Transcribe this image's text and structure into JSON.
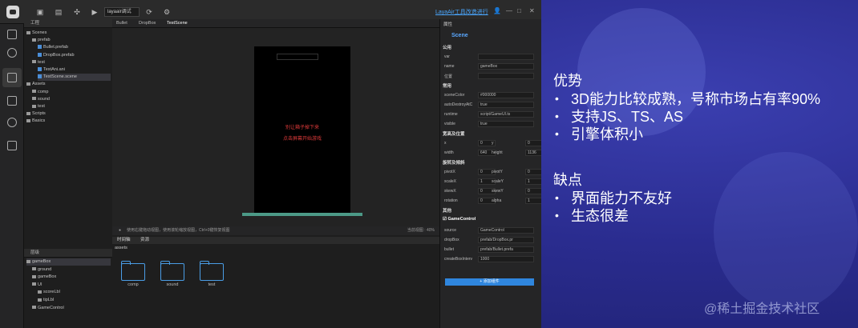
{
  "window": {
    "select_value": "layaair调试",
    "link": "LayaAir工具改造进行",
    "icons": [
      "folder-icon",
      "save-icon",
      "build-icon",
      "play-icon",
      "settings-icon"
    ]
  },
  "project_panel": {
    "title": "工程",
    "items": [
      {
        "label": "Scenes",
        "depth": 0,
        "type": "folder"
      },
      {
        "label": "prefab",
        "depth": 1,
        "type": "folder"
      },
      {
        "label": "Bullet.prefab",
        "depth": 2,
        "type": "file"
      },
      {
        "label": "DropBox.prefab",
        "depth": 2,
        "type": "file"
      },
      {
        "label": "test",
        "depth": 1,
        "type": "folder"
      },
      {
        "label": "TestAni.ani",
        "depth": 2,
        "type": "file"
      },
      {
        "label": "TestScene.scene",
        "depth": 2,
        "type": "file",
        "selected": true
      },
      {
        "label": "Assets",
        "depth": 0,
        "type": "folder"
      },
      {
        "label": "comp",
        "depth": 1,
        "type": "folder"
      },
      {
        "label": "sound",
        "depth": 1,
        "type": "folder"
      },
      {
        "label": "test",
        "depth": 1,
        "type": "folder"
      },
      {
        "label": "Scripts",
        "depth": 0,
        "type": "folder"
      },
      {
        "label": "Basics",
        "depth": 0,
        "type": "folder"
      }
    ]
  },
  "hierarchy_panel": {
    "title": "层级",
    "items": [
      {
        "label": "gameBox",
        "depth": 0,
        "selected": true
      },
      {
        "label": "ground",
        "depth": 1
      },
      {
        "label": "gameBox",
        "depth": 1
      },
      {
        "label": "UI",
        "depth": 1
      },
      {
        "label": "scoreLbl",
        "depth": 2
      },
      {
        "label": "tipLbl",
        "depth": 2
      },
      {
        "label": "GameControl",
        "depth": 1
      }
    ]
  },
  "editor": {
    "tabs": [
      "Bullet",
      "DropBox",
      "TestScene"
    ],
    "scene_text_1": "别让箱子掉下来",
    "scene_text_2": "点击屏幕开始游戏",
    "status": "使用右键拖动视图，使用滚轮缩放视图，Ctrl+0键恢复视图",
    "zoom": "当前视图 : 40%"
  },
  "bottom_panel": {
    "tabs": [
      "时间轴",
      "资源"
    ],
    "path": "assets",
    "folders": [
      "comp",
      "sound",
      "test"
    ]
  },
  "properties": {
    "title": "属性",
    "node": "Scene",
    "sections": {
      "common": "公用",
      "common_rows": [
        [
          "var",
          ""
        ],
        [
          "name",
          "gameBox"
        ],
        [
          "位置",
          ""
        ]
      ],
      "general": "常用",
      "general_rows": [
        [
          "sceneColor",
          "#000000"
        ],
        [
          "autoDestroyAtC",
          "true"
        ],
        [
          "runtime",
          "script/GameUI.ts"
        ],
        [
          "visible",
          "true"
        ]
      ],
      "width_title": "宽高及位置",
      "xy": [
        "x",
        "0",
        "y",
        "0"
      ],
      "wh": [
        "width",
        "640",
        "height",
        "1136"
      ],
      "rotate_title": "旋转及倾斜",
      "rot_rows": [
        [
          "pivotX",
          "0",
          "pivotY",
          "0"
        ],
        [
          "scaleX",
          "1",
          "scaleY",
          "1"
        ],
        [
          "skewX",
          "0",
          "skewY",
          "0"
        ],
        [
          "rotation",
          "0",
          "alpha",
          "1"
        ]
      ],
      "other": "其他",
      "component": "GameControl",
      "comp_rows": [
        [
          "source",
          "GameControl"
        ],
        [
          "dropBox",
          "prefab/DropBox.pr"
        ],
        [
          "bullet",
          "prefab/Bullet.prefa"
        ],
        [
          "createBoxInterv",
          "1000"
        ]
      ],
      "add_btn": "+ 添加组件"
    }
  },
  "slide": {
    "heading1": "优势",
    "pros": [
      "3D能力比较成熟，号称市场占有率90%",
      "支持JS、TS、AS",
      "引擎体积小"
    ],
    "heading2": "缺点",
    "cons": [
      "界面能力不友好",
      "生态很差"
    ],
    "watermark": "@稀土掘金技术社区"
  }
}
